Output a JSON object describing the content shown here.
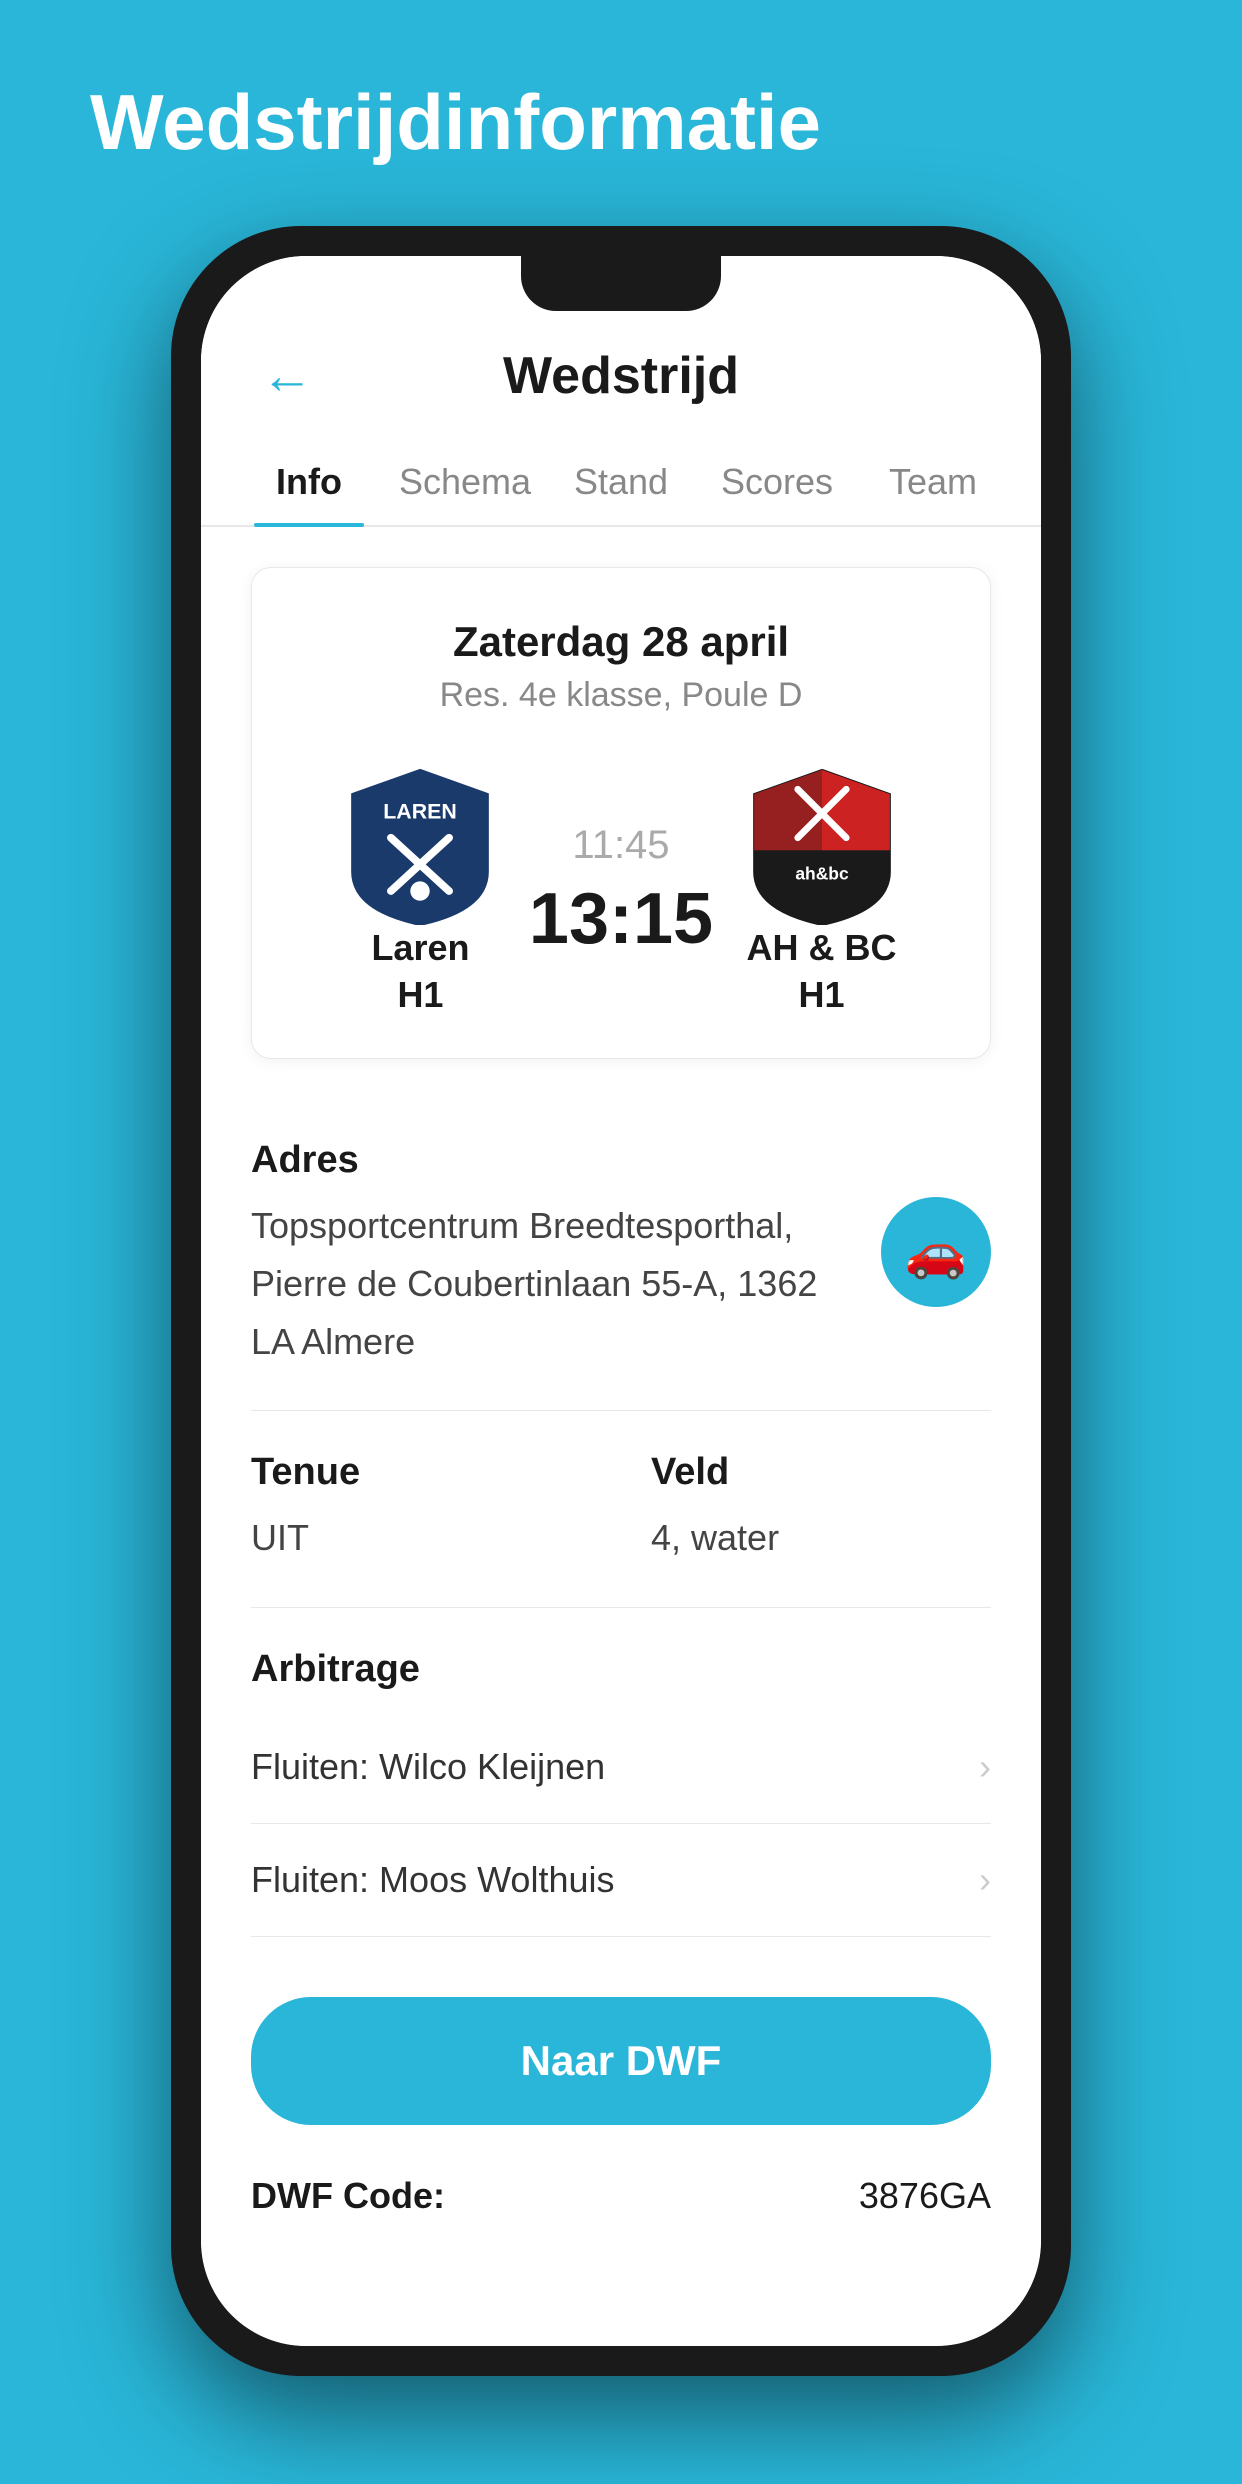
{
  "page": {
    "background_title": "Wedstrijdinformatie"
  },
  "header": {
    "title": "Wedstrijd",
    "back_label": "←"
  },
  "tabs": [
    {
      "id": "info",
      "label": "Info",
      "active": true
    },
    {
      "id": "schema",
      "label": "Schema",
      "active": false
    },
    {
      "id": "stand",
      "label": "Stand",
      "active": false
    },
    {
      "id": "scores",
      "label": "Scores",
      "active": false
    },
    {
      "id": "team",
      "label": "Team",
      "active": false
    }
  ],
  "match": {
    "date": "Zaterdag 28 april",
    "league": "Res. 4e klasse, Poule D",
    "time": "11:45",
    "score": "13:15",
    "home_team": {
      "name": "Laren",
      "sub": "H1"
    },
    "away_team": {
      "name": "AH & BC",
      "sub": "H1"
    }
  },
  "address": {
    "label": "Adres",
    "text": "Topsportcentrum Breedtesporthal, Pierre de Coubertinlaan 55-A, 1362 LA Almere"
  },
  "tenue": {
    "label": "Tenue",
    "value": "UIT"
  },
  "veld": {
    "label": "Veld",
    "value": "4, water"
  },
  "arbitrage": {
    "title": "Arbitrage",
    "referees": [
      {
        "label": "Fluiten: Wilco Kleijnen"
      },
      {
        "label": "Fluiten: Moos Wolthuis"
      }
    ]
  },
  "dwf": {
    "button_label": "Naar DWF",
    "code_label": "DWF Code:",
    "code_value": "3876GA"
  },
  "colors": {
    "primary": "#29b6d8",
    "text_dark": "#1a1a1a",
    "text_gray": "#888888"
  }
}
